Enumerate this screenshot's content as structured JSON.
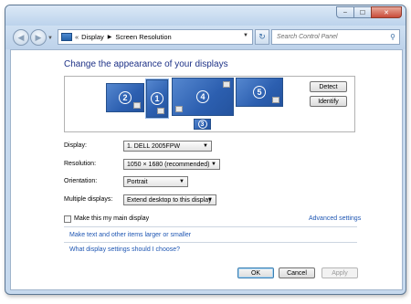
{
  "window": {
    "caption_buttons": [
      "minimize",
      "maximize",
      "close"
    ]
  },
  "navbar": {
    "address_prefix": "«",
    "breadcrumb": [
      "Display",
      "Screen Resolution"
    ],
    "search_placeholder": "Search Control Panel"
  },
  "main": {
    "heading": "Change the appearance of your displays",
    "monitors": [
      {
        "number": "2",
        "selected": false
      },
      {
        "number": "1",
        "selected": true
      },
      {
        "number": "4",
        "selected": false
      },
      {
        "number": "5",
        "selected": false
      },
      {
        "number": "3",
        "selected": false
      }
    ],
    "detect_label": "Detect",
    "identify_label": "Identify",
    "display": {
      "label": "Display:",
      "value": "1. DELL 2005FPW"
    },
    "resolution": {
      "label": "Resolution:",
      "value": "1050 × 1680 (recommended)"
    },
    "orientation": {
      "label": "Orientation:",
      "value": "Portrait"
    },
    "multiple": {
      "label": "Multiple displays:",
      "value": "Extend desktop to this display"
    },
    "main_display_label": "Make this my main display",
    "main_display_checked": false,
    "advanced_link": "Advanced settings",
    "text_size_link": "Make text and other items larger or smaller",
    "help_link": "What display settings should I choose?"
  },
  "footer": {
    "ok": "OK",
    "cancel": "Cancel",
    "apply": "Apply"
  },
  "colors": {
    "link": "#1e56b3",
    "heading": "#1e3287",
    "monitor_blue": "#2c5fb0"
  }
}
